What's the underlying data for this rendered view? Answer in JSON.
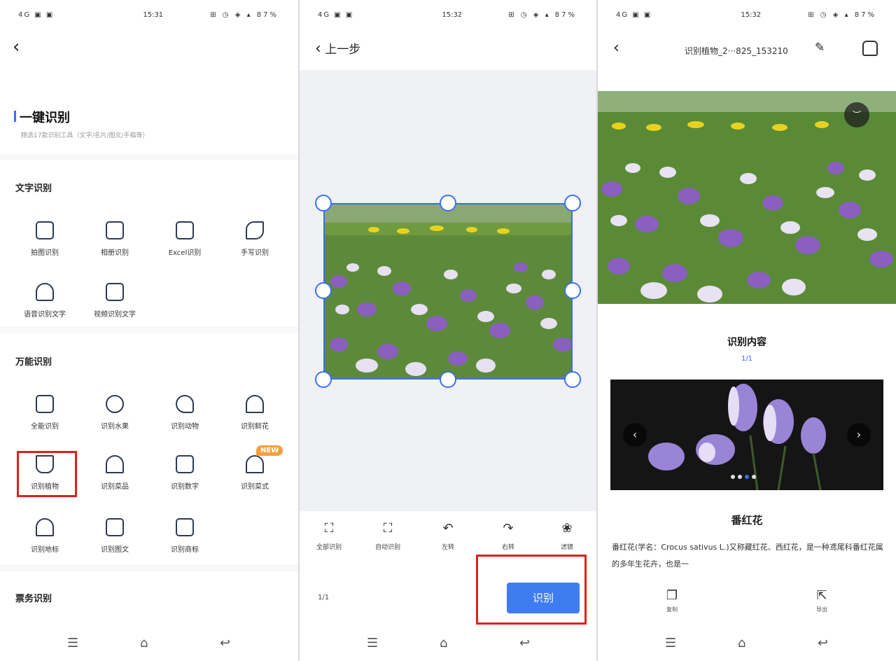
{
  "screen1": {
    "status": {
      "left": "4G ▣ ▣",
      "time": "15:31",
      "right": "⊞ ◷ ◈ ▴ 87%"
    },
    "back_icon": "‹",
    "title": "一键识别",
    "subtitle": "精选17款识别工具（文字/名片/图文/手稿等）",
    "sections": {
      "text": {
        "title": "文字识别",
        "items": [
          "拍图识别",
          "相册识别",
          "Excel识别",
          "手写识别",
          "语音识别文字",
          "视频识别文字"
        ]
      },
      "universal": {
        "title": "万能识别",
        "items": [
          "全能识别",
          "识别水果",
          "识别动物",
          "识别鲜花",
          "识别植物",
          "识别菜品",
          "识别数字",
          "识别菜式",
          "识别地标",
          "识别图文",
          "识别商标"
        ],
        "new_badge": "NEW"
      },
      "business": {
        "title": "票务识别"
      }
    }
  },
  "screen2": {
    "status": {
      "left": "4G ▣ ▣",
      "time": "15:32",
      "right": "⊞ ◷ ◈ ▴ 87%"
    },
    "prev_step": "上一步",
    "tools": [
      "全部识别",
      "自动识别",
      "左转",
      "右转",
      "滤镜"
    ],
    "page_count": "1/1",
    "recognize_button": "识别"
  },
  "screen3": {
    "status": {
      "left": "4G ▣ ▣",
      "time": "15:32",
      "right": "⊞ ◷ ◈ ▴ 87%"
    },
    "title": "识别植物_2···825_153210",
    "result_title": "识别内容",
    "result_page": "1/1",
    "flower_name": "番红花",
    "description": "番红花(学名：Crocus sativus L.)又称藏红花、西红花，是一种鸢尾科番红花属的多年生花卉，也是一",
    "actions": [
      "复制",
      "导出"
    ]
  },
  "colors": {
    "accent": "#3a6ff7",
    "highlight": "#e0201c",
    "badge": "#f5a03a"
  }
}
